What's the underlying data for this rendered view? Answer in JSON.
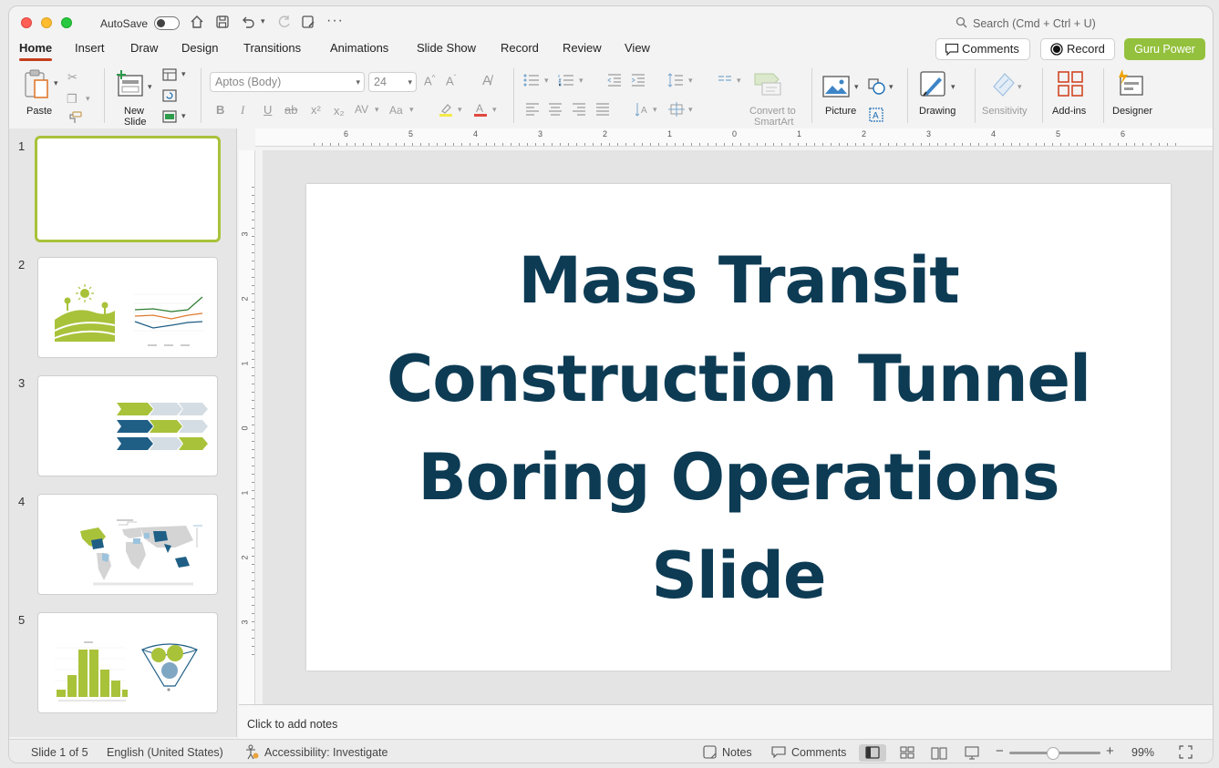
{
  "titlebar": {
    "autosave_label": "AutoSave",
    "search_placeholder": "Search (Cmd + Ctrl + U)"
  },
  "tabs": [
    "Home",
    "Insert",
    "Draw",
    "Design",
    "Transitions",
    "Animations",
    "Slide Show",
    "Record",
    "Review",
    "View"
  ],
  "actions": {
    "comments": "Comments",
    "record": "Record",
    "guru": "Guru Power"
  },
  "ribbon": {
    "paste": "Paste",
    "new_slide_1": "New",
    "new_slide_2": "Slide",
    "font_name": "Aptos (Body)",
    "font_size": "24",
    "smartart_1": "Convert to",
    "smartart_2": "SmartArt",
    "picture": "Picture",
    "drawing": "Drawing",
    "sensitivity": "Sensitivity",
    "addins": "Add-ins",
    "designer": "Designer"
  },
  "thumbnails": [
    "1",
    "2",
    "3",
    "4",
    "5"
  ],
  "slide": {
    "title_lines": [
      "Mass Transit",
      "Construction Tunnel",
      "Boring Operations",
      "Slide"
    ]
  },
  "notes_placeholder": "Click to add notes",
  "status": {
    "slide_count": "Slide 1 of 5",
    "language": "English (United States)",
    "accessibility": "Accessibility: Investigate",
    "notes": "Notes",
    "comments": "Comments",
    "zoom": "99%"
  },
  "ruler": {
    "h_ticks": [
      "6",
      "5",
      "4",
      "3",
      "2",
      "1",
      "0",
      "1",
      "2",
      "3",
      "4",
      "5",
      "6"
    ],
    "v_ticks": [
      "3",
      "2",
      "1",
      "0",
      "1",
      "2",
      "3"
    ]
  },
  "colors": {
    "accent": "#c43e1c",
    "guru": "#94c13d",
    "title_text": "#0d3b54",
    "thumb_green": "#a8c23a",
    "thumb_blue": "#1f5f86"
  }
}
